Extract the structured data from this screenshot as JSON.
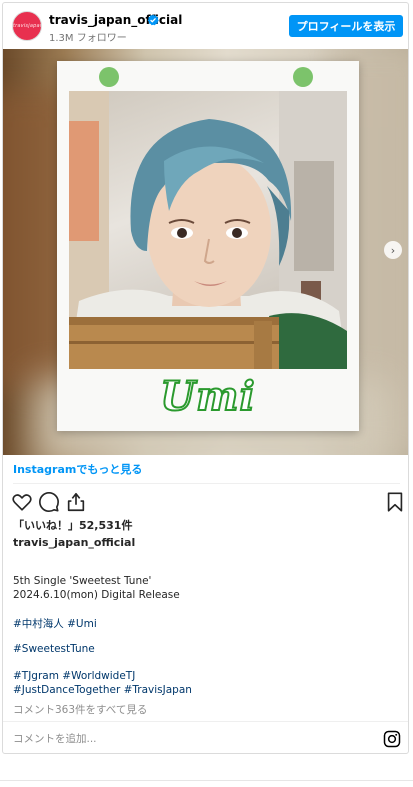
{
  "header": {
    "avatar_text": "travisjapan",
    "username": "travis_japan_official",
    "followers": "1.3M フォロワー",
    "follow_button": "プロフィールを表示"
  },
  "media": {
    "caption_name": "Umi"
  },
  "more_link": "Instagramでもっと見る",
  "likes": "「いいね！」52,531件",
  "owner": "travis_japan_official",
  "caption": {
    "line1": "5th Single 'Sweetest Tune'",
    "line2": "2024.6.10(mon) Digital Release",
    "tags1": "#中村海人 #Umi",
    "tags2": "#SweetestTune",
    "tags3": "#TJgram #WorldwideTJ",
    "tags4": "#JustDanceTogether #TravisJapan"
  },
  "view_comments": "コメント363件をすべて見る",
  "comment_placeholder": "コメントを追加...",
  "colors": {
    "accent": "#0095f6",
    "verified": "#0095f6",
    "polaroid_pin": "#7cc36b",
    "name_outline": "#2b9a2e"
  }
}
